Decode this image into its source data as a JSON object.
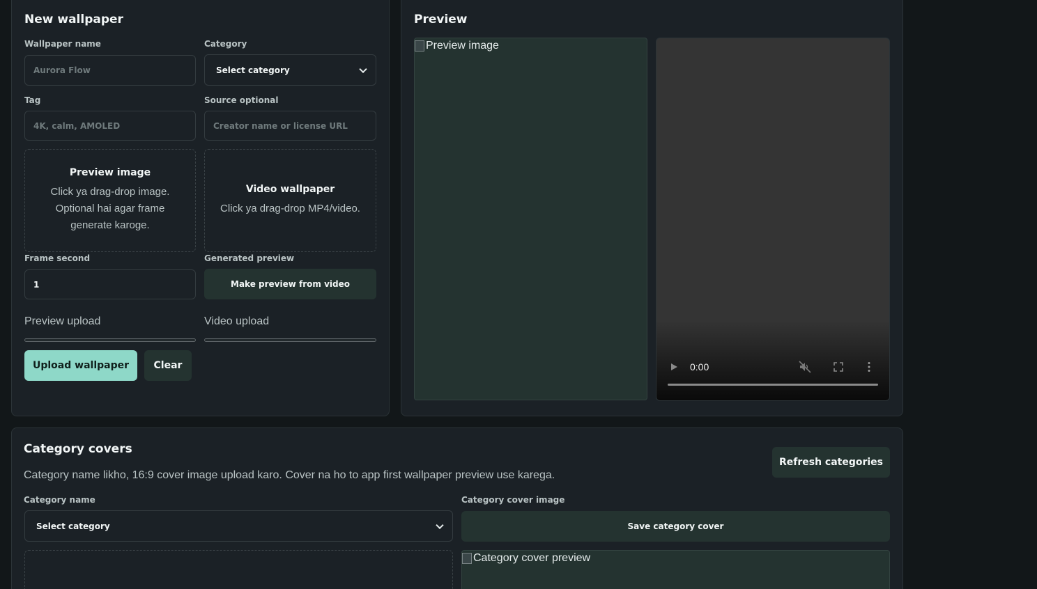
{
  "new_wallpaper": {
    "title": "New wallpaper",
    "name_label": "Wallpaper name",
    "name_placeholder": "Aurora Flow",
    "category_label": "Category",
    "category_value": "Select category",
    "tag_label": "Tag",
    "tag_placeholder": "4K, calm, AMOLED",
    "source_label": "Source optional",
    "source_placeholder": "Creator name or license URL",
    "preview_drop": {
      "title": "Preview image",
      "desc_lines": [
        "Click ya drag-drop image.",
        "Optional hai agar frame",
        "generate karoge."
      ]
    },
    "video_drop": {
      "title": "Video wallpaper",
      "desc": "Click ya drag-drop MP4/video."
    },
    "frame_label": "Frame second",
    "frame_value": "1",
    "generated_label": "Generated preview",
    "make_preview_button": "Make preview from video",
    "preview_upload_label": "Preview upload",
    "preview_upload_progress": 0,
    "video_upload_label": "Video upload",
    "video_upload_progress": 0,
    "upload_button": "Upload wallpaper",
    "clear_button": "Clear"
  },
  "preview": {
    "title": "Preview",
    "image_alt": "Preview image",
    "video_time": "0:00",
    "video_progress": 0
  },
  "category_covers": {
    "title": "Category covers",
    "refresh_button": "Refresh categories",
    "description": "Category name likho, 16:9 cover image upload karo. Cover na ho to app first wallpaper preview use karega.",
    "name_label": "Category name",
    "name_value": "Select category",
    "cover_label": "Category cover image",
    "save_button": "Save category cover",
    "cover_preview_alt": "Category cover preview"
  },
  "colors": {
    "background": "#121719",
    "panel": "#1b2126",
    "accent": "#8ed8c8",
    "dark_button": "#243330"
  }
}
